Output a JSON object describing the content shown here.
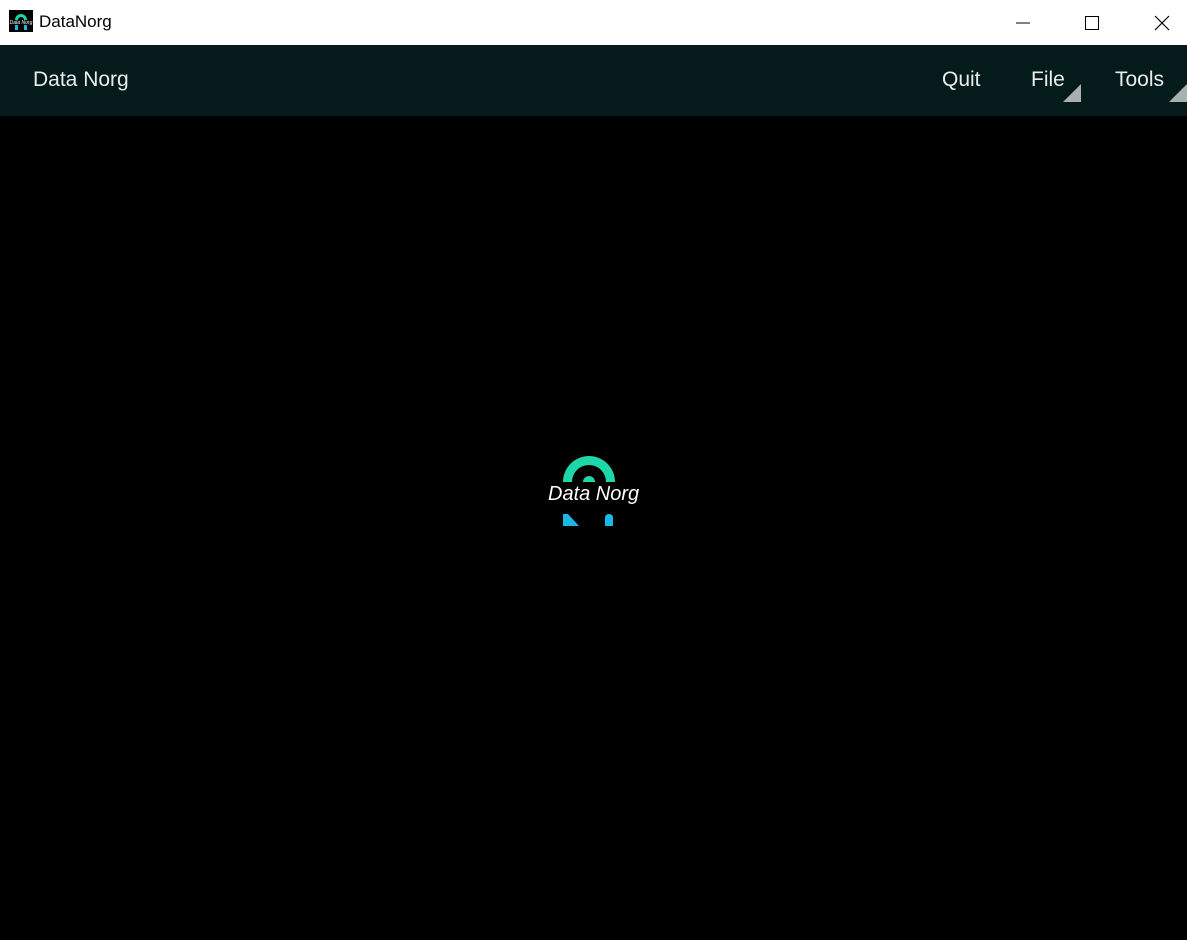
{
  "window": {
    "title": "DataNorg",
    "icon": "datanorg-logo-icon",
    "controls": [
      "minimize-icon",
      "maximize-icon",
      "close-icon"
    ]
  },
  "appbar": {
    "title": "Data Norg",
    "menu": {
      "quit_label": "Quit",
      "file_label": "File",
      "tools_label": "Tools"
    }
  },
  "content": {
    "logo_text": "Data Norg",
    "logo_colors": {
      "arch": "#1fd6a8",
      "base": "#18b9e6"
    }
  },
  "colors": {
    "titlebar_bg": "#ffffff",
    "appbar_bg": "#041a1b",
    "content_bg": "#000000",
    "text_light": "#e8ecec"
  }
}
